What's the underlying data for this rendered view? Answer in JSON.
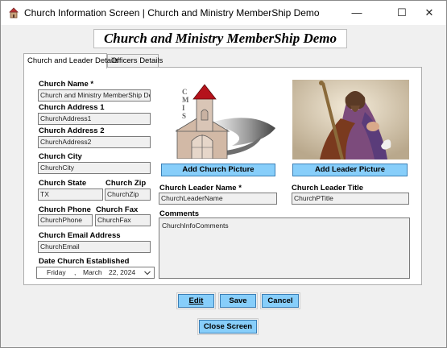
{
  "window": {
    "title": "Church Information Screen | Church and Ministry MemberShip Demo",
    "minimize_glyph": "—",
    "maximize_glyph": "☐",
    "close_glyph": "✕"
  },
  "heading": "Church and Ministry MemberShip Demo",
  "tabs": [
    {
      "label": "Church and Leader Details",
      "active": true
    },
    {
      "label": "Officers Details",
      "active": false
    }
  ],
  "church": {
    "name_label": "Church Name *",
    "name_value": "Church and Ministry MemberShip Demo",
    "address1_label": "Church Address 1",
    "address1_value": "ChurchAddress1",
    "address2_label": "Church Address 2",
    "address2_value": "ChurchAddress2",
    "city_label": "Church City",
    "city_value": "ChurchCity",
    "state_label": "Church State",
    "state_value": "TX",
    "zip_label": "Church Zip",
    "zip_value": "ChurchZip",
    "phone_label": "Church Phone",
    "phone_value": "ChurchPhone",
    "fax_label": "Church Fax",
    "fax_value": "ChurchFax",
    "email_label": "Church Email Address",
    "email_value": "ChurchEmail",
    "established_label": "Date Church Established",
    "established_value": {
      "weekday": "Friday",
      "sep": ",",
      "month": "March",
      "day": "22, 2024"
    }
  },
  "pictures": {
    "church_logo_text": "CMIS",
    "add_church_picture": "Add Church Picture",
    "add_leader_picture": "Add Leader Picture"
  },
  "leader": {
    "name_label": "Church Leader Name *",
    "name_value": "ChurchLeaderName",
    "title_label": "Church Leader Title",
    "title_value": "ChurchPTitle"
  },
  "comments": {
    "label": "Comments",
    "value": "ChurchInfoComments"
  },
  "actions": {
    "edit": "Edit",
    "save": "Save",
    "cancel": "Cancel",
    "close": "Close Screen"
  },
  "colors": {
    "button_fill": "#87cefa",
    "window_bg": "#f0f0f0",
    "field_bg": "#f0f0f0"
  }
}
